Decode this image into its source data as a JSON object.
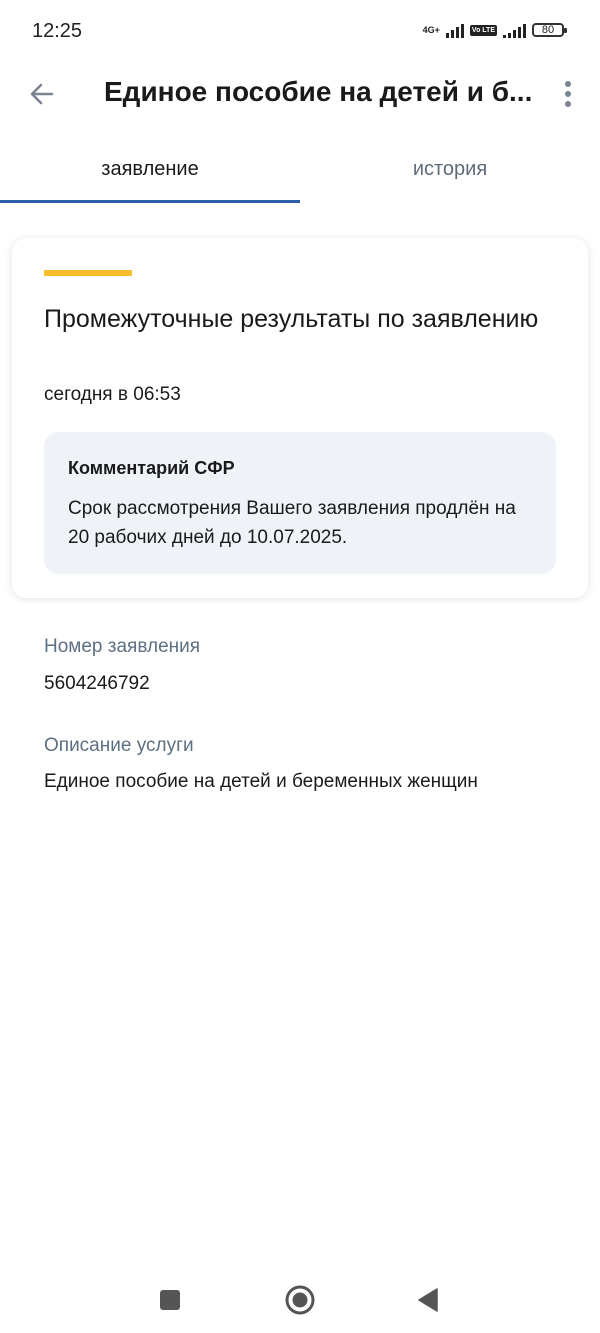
{
  "status_bar": {
    "time": "12:25",
    "network": "4G+",
    "volte": "Vo LTE",
    "battery": "80"
  },
  "app_bar": {
    "title": "Единое пособие на детей и б..."
  },
  "tabs": [
    {
      "label": "заявление",
      "active": true
    },
    {
      "label": "история",
      "active": false
    }
  ],
  "card": {
    "title": "Промежуточные результаты по заявлению",
    "date": "сегодня в 06:53",
    "comment": {
      "title": "Комментарий СФР",
      "text": "Срок рассмотрения Вашего заявления продлён на 20 рабочих дней до 10.07.2025."
    }
  },
  "application_number": {
    "label": "Номер заявления",
    "value": "5604246792"
  },
  "service_description": {
    "label": "Описание услуги",
    "value": "Единое пособие на детей и беременных женщин"
  },
  "colors": {
    "accent_yellow": "#f7bd2a",
    "tab_indicator": "#2a5ea8",
    "label_gray": "#5d6f83",
    "comment_bg": "#eff3f8"
  },
  "icons": {
    "back": "arrow-left-icon",
    "more": "more-vertical-icon",
    "nav_recents": "square-icon",
    "nav_home": "circle-icon",
    "nav_back": "triangle-left-icon"
  }
}
